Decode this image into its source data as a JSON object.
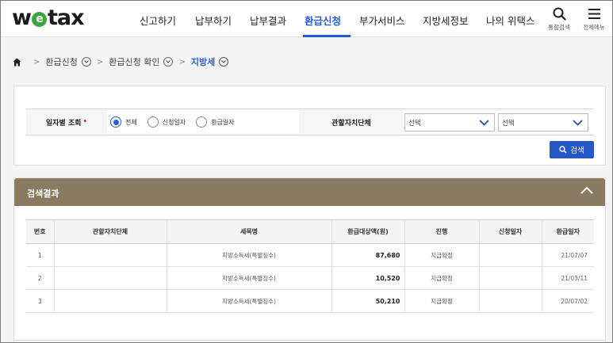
{
  "header": {
    "logo": {
      "pre": "w",
      "e": "e",
      "post": "tax"
    },
    "nav": [
      {
        "label": "신고하기"
      },
      {
        "label": "납부하기"
      },
      {
        "label": "납부결과"
      },
      {
        "label": "환급신청",
        "active": true
      },
      {
        "label": "부가서비스"
      },
      {
        "label": "지방세정보"
      },
      {
        "label": "나의 위택스"
      }
    ],
    "search_label": "통합검색",
    "menu_label": "전체메뉴",
    "accent_color": "#2a5bd7"
  },
  "breadcrumb": {
    "home_icon": "home-icon",
    "items": [
      "환급신청",
      "환급신청 확인",
      "지방세"
    ]
  },
  "filter": {
    "date_label": "일자별 조회",
    "required_mark": "•",
    "radio_options": [
      "전체",
      "신청일자",
      "환급일자"
    ],
    "selected_radio": "전체",
    "region_label": "관할자치단체",
    "select1_value": "선택",
    "select2_value": "선택",
    "search_button": "검색"
  },
  "results": {
    "title": "검색결과",
    "header_color": "#8a7a62",
    "columns": [
      "번호",
      "관할자치단체",
      "세목명",
      "환급대상액(원)",
      "진행",
      "신청일자",
      "환급일자"
    ],
    "rows": [
      {
        "no": "1",
        "region": "",
        "tax": "지방소득세(특별징수)",
        "amount": "87,680",
        "status": "지급확정",
        "applied": "",
        "refund_date": "21/07/07"
      },
      {
        "no": "2",
        "region": "",
        "tax": "지방소득세(특별징수)",
        "amount": "10,520",
        "status": "지급확정",
        "applied": "",
        "refund_date": "21/03/11"
      },
      {
        "no": "3",
        "region": "",
        "tax": "지방소득세(특별징수)",
        "amount": "50,210",
        "status": "지급확정",
        "applied": "",
        "refund_date": "20/07/02"
      }
    ]
  }
}
